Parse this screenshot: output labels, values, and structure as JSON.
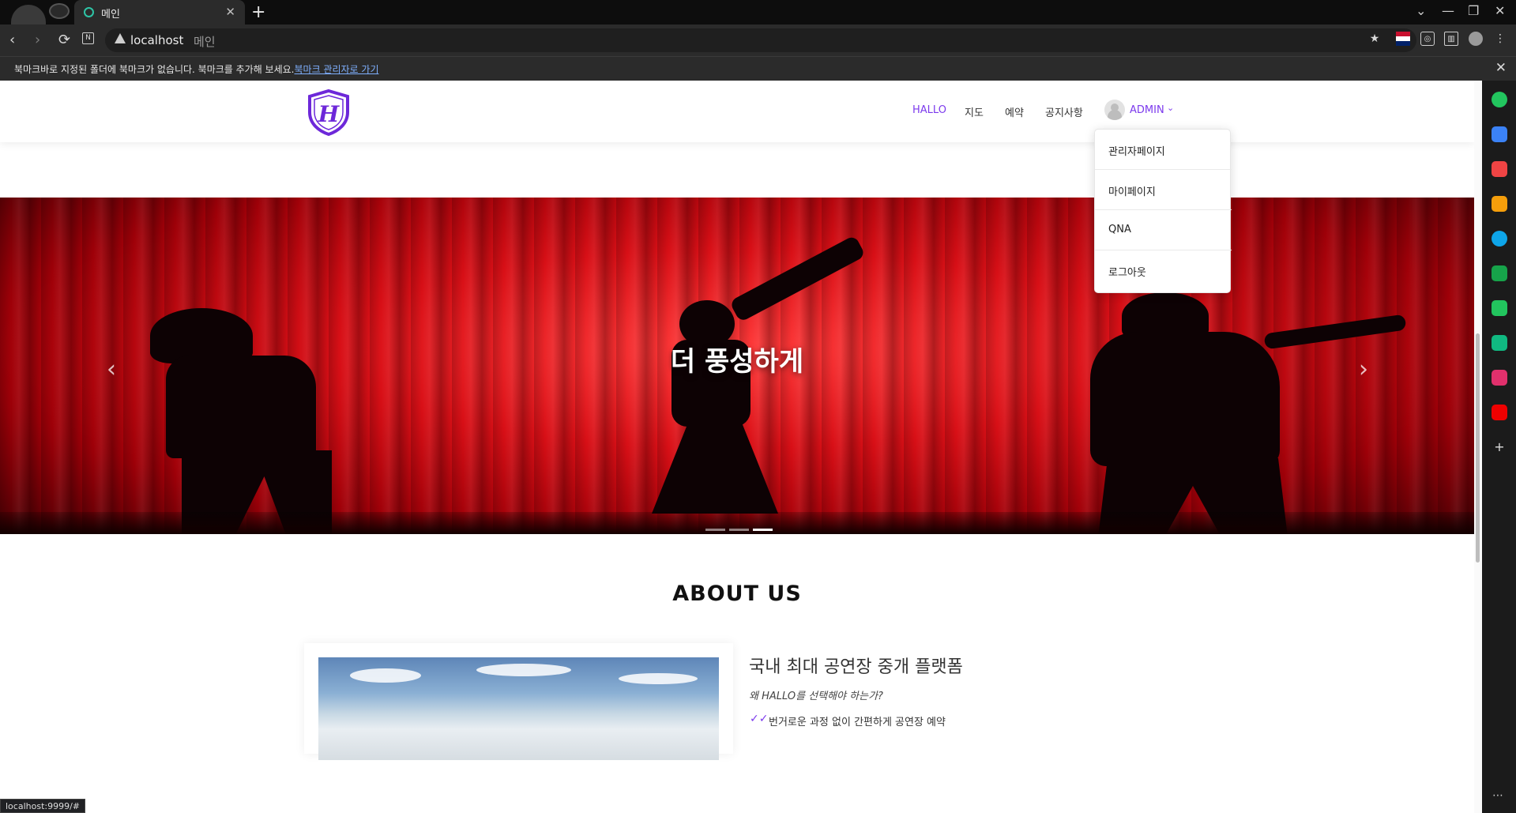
{
  "browser": {
    "tab_title": "메인",
    "tab_close": "✕",
    "new_tab": "+",
    "address_host": "localhost",
    "address_title": "메인",
    "status_url": "localhost:9999/#",
    "window_controls": [
      "⌄",
      "—",
      "❐",
      "✕"
    ],
    "back": "‹",
    "forward": "›",
    "reload": "⟳",
    "zoom_icon": "⌕"
  },
  "bookmark_bar": {
    "message": "북마크바로 지정된 폴더에 북마크가 없습니다. 북마크를 추가해 보세요.",
    "link": "북마크 관리자로 가기",
    "close": "✕"
  },
  "site_header": {
    "nav": [
      "HALLO",
      "지도",
      "예약",
      "공지사항"
    ],
    "user_label": "ADMIN",
    "chevron": "⌄"
  },
  "dropdown": {
    "items": [
      "관리자페이지",
      "마이페이지",
      "QNA",
      "로그아웃"
    ]
  },
  "hero": {
    "title": "더 풍성하게",
    "prev": "‹",
    "next": "›",
    "slide_count": 3,
    "active_slide": 3
  },
  "about": {
    "title": "ABOUT US",
    "heading": "국내 최대 공연장 중개 플랫폼",
    "subheading": "왜 HALLO를 선택해야 하는가?",
    "check_icon": "✓✓",
    "points": [
      "번거로운 과정 없이 간편하게 공연장 예약"
    ]
  },
  "side_panel": {
    "icons": [
      {
        "name": "circle-icon",
        "color": "#22c55e"
      },
      {
        "name": "briefcase-icon",
        "color": "#3b82f6"
      },
      {
        "name": "pocket-icon",
        "color": "#ef4444"
      },
      {
        "name": "star-icon",
        "color": "#f59e0b"
      },
      {
        "name": "edge-icon",
        "color": "#0ea5e9"
      },
      {
        "name": "naver-icon",
        "color": "#16a34a"
      },
      {
        "name": "chart-icon",
        "color": "#22c55e"
      },
      {
        "name": "webtoon-icon",
        "color": "#10b981"
      },
      {
        "name": "instagram-icon",
        "color": "#e1306c"
      },
      {
        "name": "youtube-icon",
        "color": "#ef0000"
      }
    ],
    "add": "+",
    "more": "⋯"
  },
  "colors": {
    "accent": "#7c3aed",
    "hero_red": "#d80f16"
  }
}
